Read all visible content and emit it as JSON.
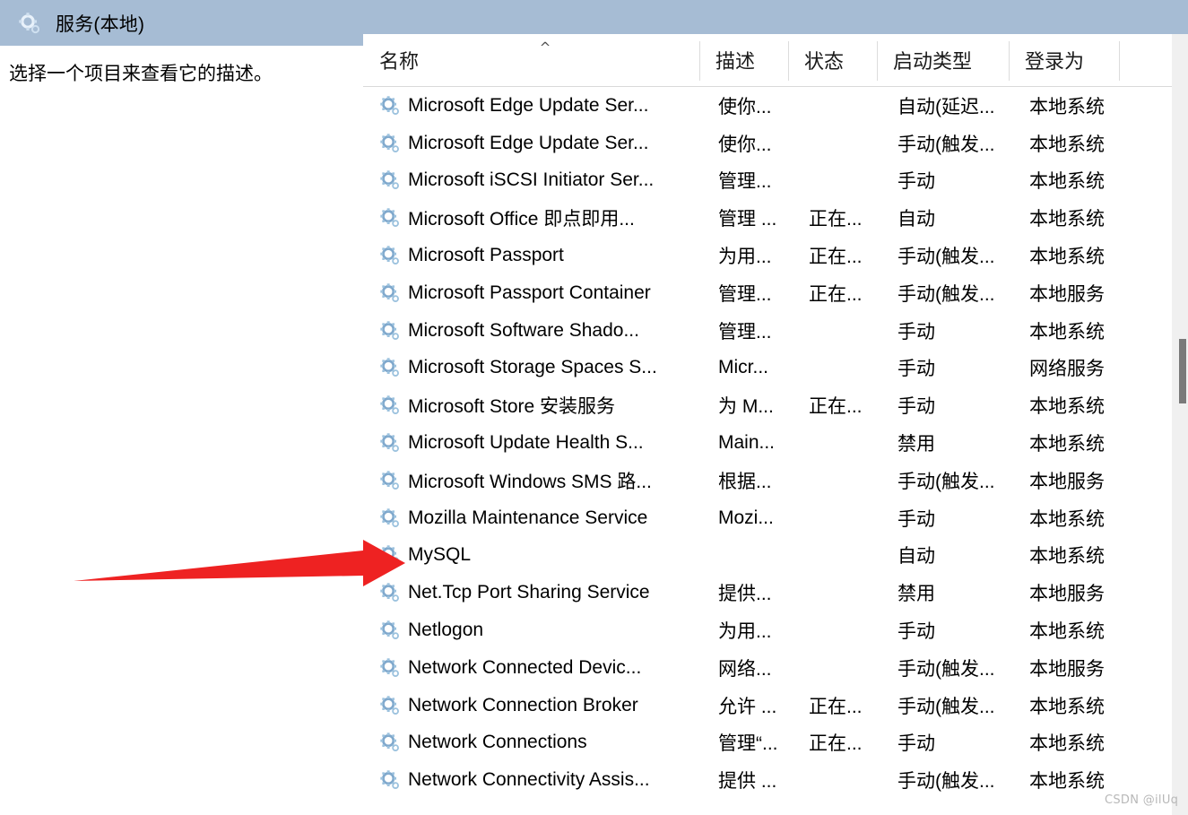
{
  "window": {
    "title": "服务(本地)",
    "icon": "services-gear-icon",
    "header_bg": "#a6bcd4"
  },
  "detail_pane": {
    "hint_text": "选择一个项目来查看它的描述。"
  },
  "list": {
    "sort_indicator": "^",
    "sort_column": "名称",
    "columns": [
      {
        "key": "name",
        "label": "名称"
      },
      {
        "key": "desc",
        "label": "描述"
      },
      {
        "key": "state",
        "label": "状态"
      },
      {
        "key": "start",
        "label": "启动类型"
      },
      {
        "key": "logon",
        "label": "登录为"
      }
    ],
    "row_icon": "service-gear-icon",
    "rows": [
      {
        "name": "Microsoft Edge Update Ser...",
        "desc": "使你...",
        "state": "",
        "start": "自动(延迟...",
        "logon": "本地系统"
      },
      {
        "name": "Microsoft Edge Update Ser...",
        "desc": "使你...",
        "state": "",
        "start": "手动(触发...",
        "logon": "本地系统"
      },
      {
        "name": "Microsoft iSCSI Initiator Ser...",
        "desc": "管理...",
        "state": "",
        "start": "手动",
        "logon": "本地系统"
      },
      {
        "name": "Microsoft Office 即点即用...",
        "desc": "管理 ...",
        "state": "正在...",
        "start": "自动",
        "logon": "本地系统"
      },
      {
        "name": "Microsoft Passport",
        "desc": "为用...",
        "state": "正在...",
        "start": "手动(触发...",
        "logon": "本地系统"
      },
      {
        "name": "Microsoft Passport Container",
        "desc": "管理...",
        "state": "正在...",
        "start": "手动(触发...",
        "logon": "本地服务"
      },
      {
        "name": "Microsoft Software Shado...",
        "desc": "管理...",
        "state": "",
        "start": "手动",
        "logon": "本地系统"
      },
      {
        "name": "Microsoft Storage Spaces S...",
        "desc": "Micr...",
        "state": "",
        "start": "手动",
        "logon": "网络服务"
      },
      {
        "name": "Microsoft Store 安装服务",
        "desc": "为 M...",
        "state": "正在...",
        "start": "手动",
        "logon": "本地系统"
      },
      {
        "name": "Microsoft Update Health S...",
        "desc": "Main...",
        "state": "",
        "start": "禁用",
        "logon": "本地系统"
      },
      {
        "name": "Microsoft Windows SMS 路...",
        "desc": "根据...",
        "state": "",
        "start": "手动(触发...",
        "logon": "本地服务"
      },
      {
        "name": "Mozilla Maintenance Service",
        "desc": "Mozi...",
        "state": "",
        "start": "手动",
        "logon": "本地系统"
      },
      {
        "name": "MySQL",
        "desc": "",
        "state": "",
        "start": "自动",
        "logon": "本地系统"
      },
      {
        "name": "Net.Tcp Port Sharing Service",
        "desc": "提供...",
        "state": "",
        "start": "禁用",
        "logon": "本地服务"
      },
      {
        "name": "Netlogon",
        "desc": "为用...",
        "state": "",
        "start": "手动",
        "logon": "本地系统"
      },
      {
        "name": "Network Connected Devic...",
        "desc": "网络...",
        "state": "",
        "start": "手动(触发...",
        "logon": "本地服务"
      },
      {
        "name": "Network Connection Broker",
        "desc": "允许 ...",
        "state": "正在...",
        "start": "手动(触发...",
        "logon": "本地系统"
      },
      {
        "name": "Network Connections",
        "desc": "管理“...",
        "state": "正在...",
        "start": "手动",
        "logon": "本地系统"
      },
      {
        "name": "Network Connectivity Assis...",
        "desc": "提供 ...",
        "state": "",
        "start": "手动(触发...",
        "logon": "本地系统"
      }
    ]
  },
  "annotation": {
    "arrow_color": "#ee2222",
    "points_to": "MySQL"
  },
  "watermark": {
    "text": "CSDN @ilUq"
  }
}
